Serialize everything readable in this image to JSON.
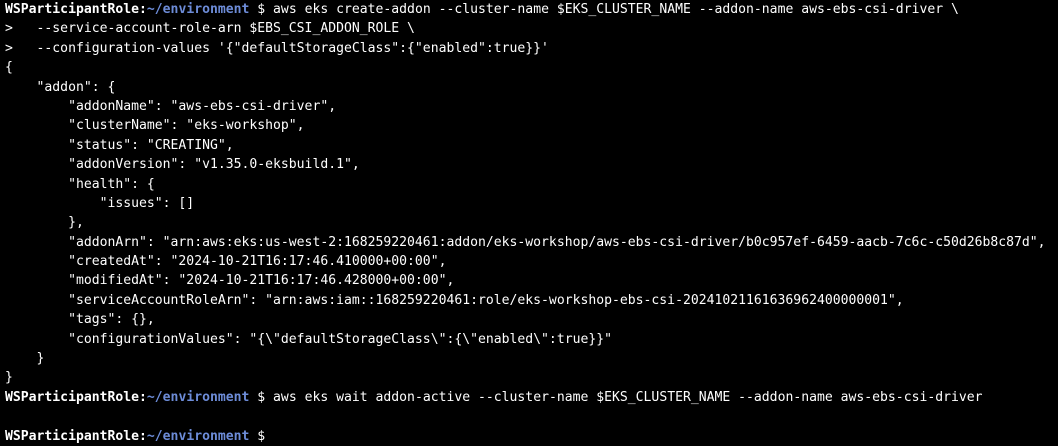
{
  "colors": {
    "background": "#000000",
    "text": "#ffffff",
    "path": "#6d8cd8"
  },
  "prompt": {
    "user": "WSParticipantRole",
    "separator": ":",
    "path": "~/environment",
    "symbol": " $ "
  },
  "lines": [
    {
      "type": "prompt",
      "command": "aws eks create-addon --cluster-name $EKS_CLUSTER_NAME --addon-name aws-ebs-csi-driver \\"
    },
    {
      "type": "text",
      "text": ">   --service-account-role-arn $EBS_CSI_ADDON_ROLE \\"
    },
    {
      "type": "text",
      "text": ">   --configuration-values '{\"defaultStorageClass\":{\"enabled\":true}}'"
    },
    {
      "type": "text",
      "text": "{"
    },
    {
      "type": "text",
      "text": "    \"addon\": {"
    },
    {
      "type": "text",
      "text": "        \"addonName\": \"aws-ebs-csi-driver\","
    },
    {
      "type": "text",
      "text": "        \"clusterName\": \"eks-workshop\","
    },
    {
      "type": "text",
      "text": "        \"status\": \"CREATING\","
    },
    {
      "type": "text",
      "text": "        \"addonVersion\": \"v1.35.0-eksbuild.1\","
    },
    {
      "type": "text",
      "text": "        \"health\": {"
    },
    {
      "type": "text",
      "text": "            \"issues\": []"
    },
    {
      "type": "text",
      "text": "        },"
    },
    {
      "type": "text",
      "text": "        \"addonArn\": \"arn:aws:eks:us-west-2:168259220461:addon/eks-workshop/aws-ebs-csi-driver/b0c957ef-6459-aacb-7c6c-c50d26b8c87d\","
    },
    {
      "type": "text",
      "text": "        \"createdAt\": \"2024-10-21T16:17:46.410000+00:00\","
    },
    {
      "type": "text",
      "text": "        \"modifiedAt\": \"2024-10-21T16:17:46.428000+00:00\","
    },
    {
      "type": "text",
      "text": "        \"serviceAccountRoleArn\": \"arn:aws:iam::168259220461:role/eks-workshop-ebs-csi-20241021161636962400000001\","
    },
    {
      "type": "text",
      "text": "        \"tags\": {},"
    },
    {
      "type": "text",
      "text": "        \"configurationValues\": \"{\\\"defaultStorageClass\\\":{\\\"enabled\\\":true}}\""
    },
    {
      "type": "text",
      "text": "    }"
    },
    {
      "type": "text",
      "text": "}"
    },
    {
      "type": "prompt",
      "command": "aws eks wait addon-active --cluster-name $EKS_CLUSTER_NAME --addon-name aws-ebs-csi-driver"
    },
    {
      "type": "text",
      "text": ""
    },
    {
      "type": "prompt",
      "command": ""
    }
  ]
}
